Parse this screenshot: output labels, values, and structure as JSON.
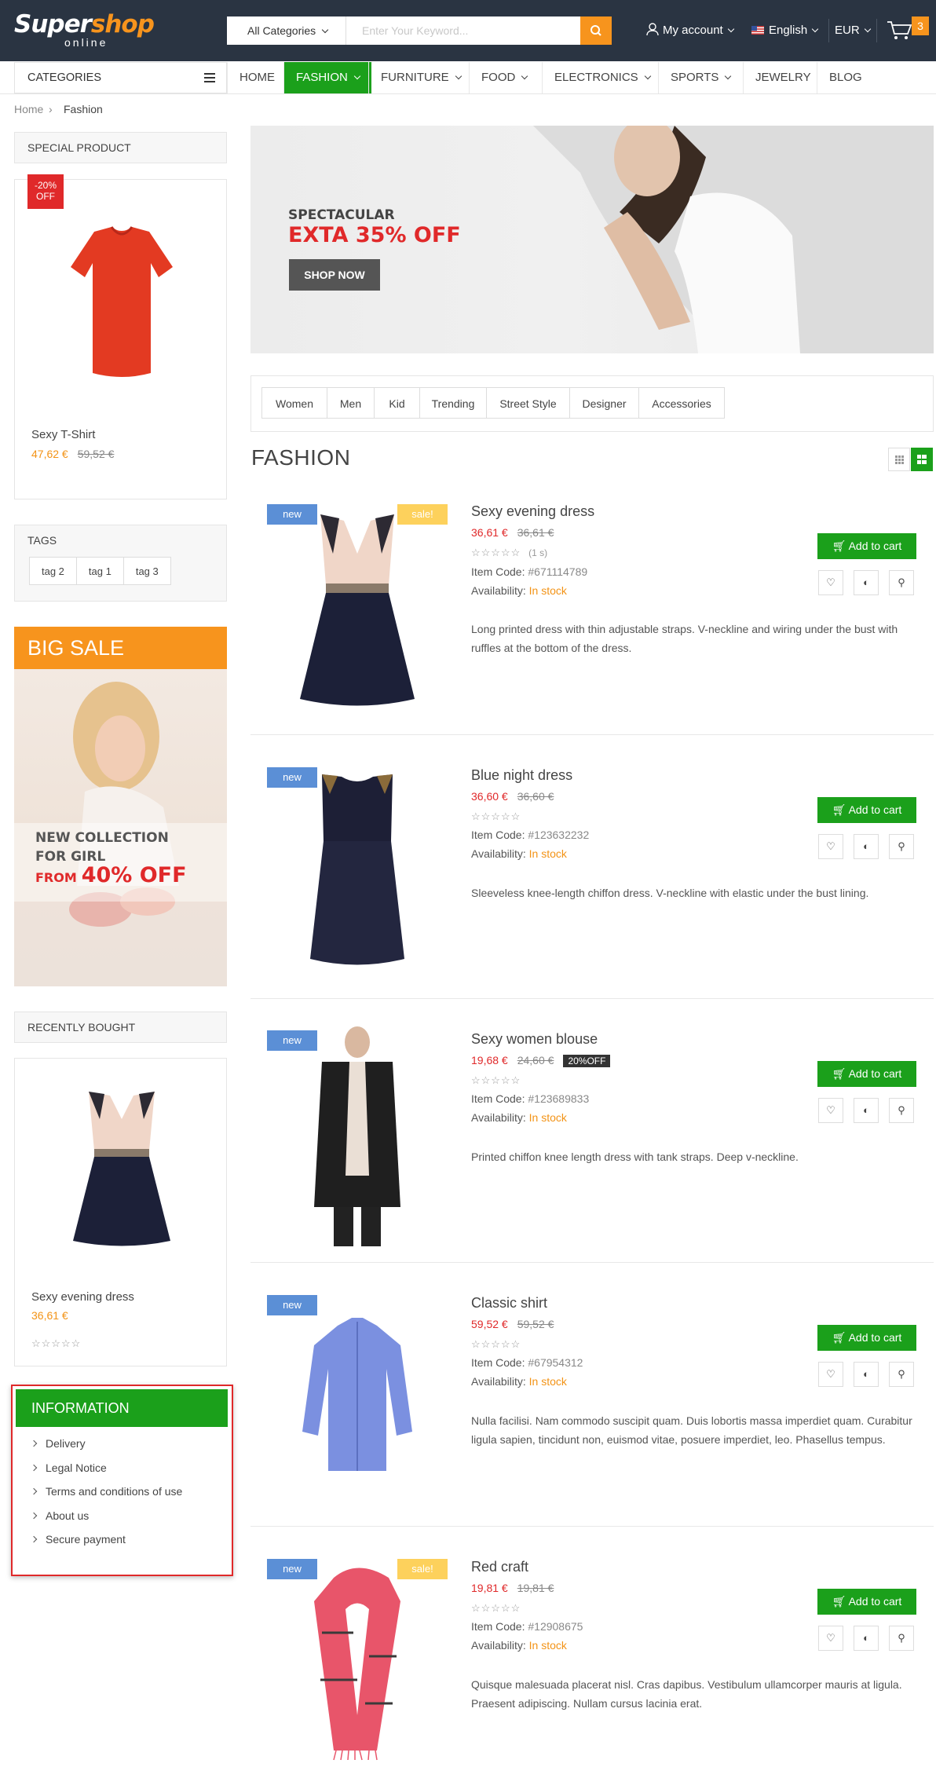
{
  "header": {
    "logo_main": "Super",
    "logo_accent": "shop",
    "logo_sub": "online",
    "category_select": "All Categories",
    "search_placeholder": "Enter Your Keyword...",
    "account": "My account",
    "language": "English",
    "currency": "EUR",
    "cart_count": "3"
  },
  "nav": {
    "categories_label": "CATEGORIES",
    "items": [
      {
        "label": "HOME"
      },
      {
        "label": "FASHION"
      },
      {
        "label": "FURNITURE"
      },
      {
        "label": "FOOD"
      },
      {
        "label": "ELECTRONICS"
      },
      {
        "label": "SPORTS"
      },
      {
        "label": "JEWELRY"
      },
      {
        "label": "BLOG"
      }
    ]
  },
  "breadcrumb": {
    "home": "Home",
    "current": "Fashion"
  },
  "sidebar": {
    "special": {
      "title": "SPECIAL PRODUCT",
      "badge_pct": "-20%",
      "badge_off": "OFF",
      "name": "Sexy T-Shirt",
      "price": "47,62 €",
      "old_price": "59,52 €"
    },
    "tags": {
      "title": "TAGS",
      "items": [
        "tag 2",
        "tag 1",
        "tag 3"
      ]
    },
    "promo": {
      "title": "BIG SALE",
      "line1": "NEW COLLECTION",
      "line2": "FOR GIRL",
      "from": "FROM",
      "pct": "40% OFF"
    },
    "recent": {
      "title": "RECENTLY BOUGHT",
      "name": "Sexy evening dress",
      "price": "36,61 €",
      "stars": "☆☆☆☆☆"
    },
    "info": {
      "title": "INFORMATION",
      "items": [
        "Delivery",
        "Legal Notice",
        "Terms and conditions of use",
        "About us",
        "Secure payment"
      ]
    }
  },
  "banner": {
    "kicker": "SPECTACULAR",
    "headline": "EXTA 35% OFF",
    "button": "SHOP NOW"
  },
  "filters": [
    "Women",
    "Men",
    "Kid",
    "Trending",
    "Street Style",
    "Designer",
    "Accessories"
  ],
  "page_title": "FASHION",
  "labels": {
    "new": "new",
    "sale": "sale!",
    "add_to_cart": "Add to cart",
    "item_code": "Item Code:",
    "availability": "Availability:",
    "in_stock": "In stock",
    "stars": "☆☆☆☆☆",
    "reviews": "(1 s)",
    "off_badge": "20%OFF"
  },
  "products": [
    {
      "name": "Sexy evening dress",
      "price": "36,61 €",
      "old_price": "36,61 €",
      "code": "#671114789",
      "desc": "Long printed dress with thin adjustable straps. V-neckline and wiring under the bust with ruffles at the bottom of the dress."
    },
    {
      "name": "Blue night dress",
      "price": "36,60 €",
      "old_price": "36,60 €",
      "code": "#123632232",
      "desc": "Sleeveless knee-length chiffon dress. V-neckline with elastic under the bust lining."
    },
    {
      "name": "Sexy women blouse",
      "price": "19,68 €",
      "old_price": "24,60 €",
      "code": "#123689833",
      "desc": "Printed chiffon knee length dress with tank straps. Deep v-neckline."
    },
    {
      "name": "Classic shirt",
      "price": "59,52 €",
      "old_price": "59,52 €",
      "code": "#67954312",
      "desc": "Nulla facilisi. Nam commodo suscipit quam. Duis lobortis massa imperdiet quam. Curabitur ligula sapien, tincidunt non, euismod vitae, posuere imperdiet, leo. Phasellus tempus."
    },
    {
      "name": "Red craft",
      "price": "19,81 €",
      "old_price": "19,81 €",
      "code": "#12908675",
      "desc": "Quisque malesuada placerat nisl. Cras dapibus. Vestibulum ullamcorper mauris at ligula. Praesent adipiscing. Nullam cursus lacinia erat."
    }
  ],
  "colors": {
    "brand_green": "#1ba01b",
    "accent_orange": "#f7941d",
    "header_bg": "#2a3442",
    "badge_new": "#5b8fd6",
    "badge_sale": "#fdd15c",
    "price_red": "#e0292a",
    "highlight_border": "#e0292a"
  }
}
